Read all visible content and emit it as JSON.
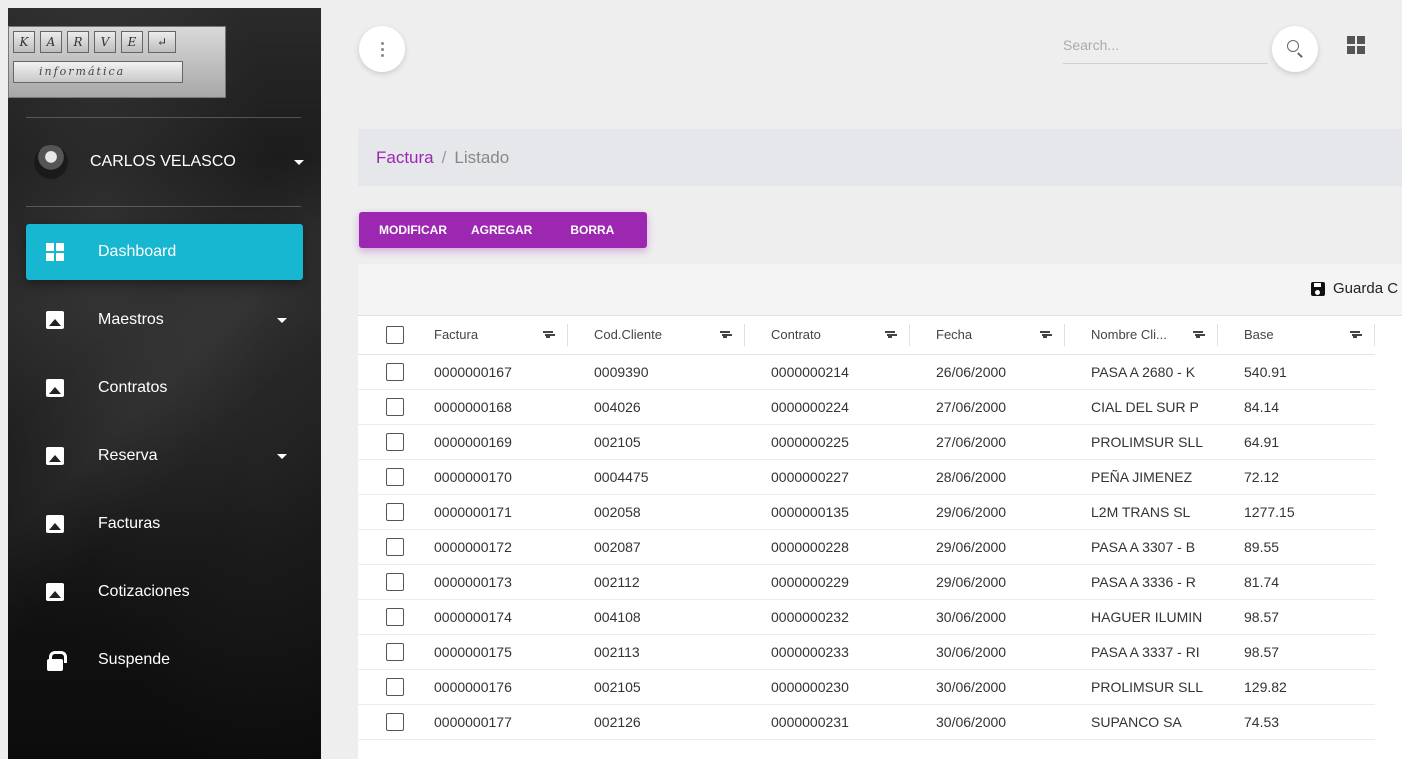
{
  "logo": {
    "keys": [
      "K",
      "A",
      "R",
      "V",
      "E"
    ],
    "enter_glyph": "↵",
    "subtitle": "informática"
  },
  "user": {
    "name": "CARLOS VELASCO"
  },
  "nav": [
    {
      "label": "Dashboard",
      "icon": "dashboard-icon",
      "active": true,
      "dropdown": false
    },
    {
      "label": "Maestros",
      "icon": "image-icon",
      "active": false,
      "dropdown": true
    },
    {
      "label": "Contratos",
      "icon": "image-icon",
      "active": false,
      "dropdown": false
    },
    {
      "label": "Reserva",
      "icon": "image-icon",
      "active": false,
      "dropdown": true
    },
    {
      "label": "Facturas",
      "icon": "image-icon",
      "active": false,
      "dropdown": false
    },
    {
      "label": "Cotizaciones",
      "icon": "image-icon",
      "active": false,
      "dropdown": false
    },
    {
      "label": "Suspende",
      "icon": "lock-icon",
      "active": false,
      "dropdown": false
    }
  ],
  "search": {
    "placeholder": "Search..."
  },
  "breadcrumb": {
    "link": "Factura",
    "separator": "/",
    "current": "Listado"
  },
  "actions": {
    "modificar": "MODIFICAR",
    "agregar": "AGREGAR",
    "borra": "BORRA"
  },
  "grid": {
    "save_label": "Guarda C",
    "columns": [
      "Factura",
      "Cod.Cliente",
      "Contrato",
      "Fecha",
      "Nombre Cli...",
      "Base"
    ],
    "rows": [
      [
        "0000000167",
        "0009390",
        "0000000214",
        "26/06/2000",
        "PASA A 2680 - K",
        "540.91"
      ],
      [
        "0000000168",
        "004026",
        "0000000224",
        "27/06/2000",
        "CIAL DEL SUR P",
        "84.14"
      ],
      [
        "0000000169",
        "002105",
        "0000000225",
        "27/06/2000",
        "PROLIMSUR SLL",
        "64.91"
      ],
      [
        "0000000170",
        "0004475",
        "0000000227",
        "28/06/2000",
        "PEÑA JIMENEZ",
        "72.12"
      ],
      [
        "0000000171",
        "002058",
        "0000000135",
        "29/06/2000",
        "L2M TRANS SL",
        "1277.15"
      ],
      [
        "0000000172",
        "002087",
        "0000000228",
        "29/06/2000",
        "PASA A 3307 - B",
        "89.55"
      ],
      [
        "0000000173",
        "002112",
        "0000000229",
        "29/06/2000",
        "PASA A 3336 - R",
        "81.74"
      ],
      [
        "0000000174",
        "004108",
        "0000000232",
        "30/06/2000",
        "HAGUER ILUMIN",
        "98.57"
      ],
      [
        "0000000175",
        "002113",
        "0000000233",
        "30/06/2000",
        "PASA A 3337 - RI",
        "98.57"
      ],
      [
        "0000000176",
        "002105",
        "0000000230",
        "30/06/2000",
        "PROLIMSUR SLL",
        "129.82"
      ],
      [
        "0000000177",
        "002126",
        "0000000231",
        "30/06/2000",
        "SUPANCO SA",
        "74.53"
      ]
    ]
  },
  "colors": {
    "accent": "#9c27b0",
    "active_nav": "#17b6d1"
  }
}
